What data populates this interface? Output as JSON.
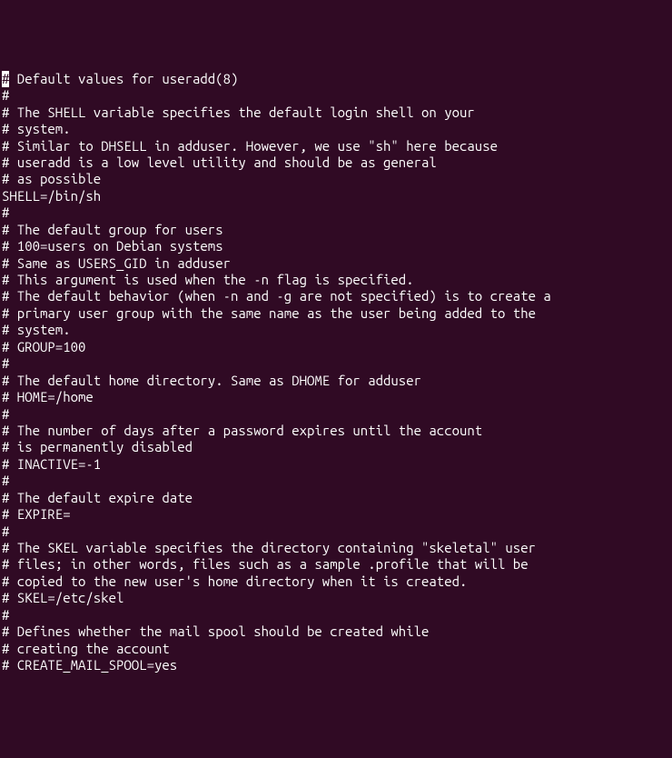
{
  "lines": [
    {
      "cursor": true,
      "cursorChar": "#",
      "rest": " Default values for useradd(8)"
    },
    {
      "text": "#"
    },
    {
      "text": "# The SHELL variable specifies the default login shell on your"
    },
    {
      "text": "# system."
    },
    {
      "text": "# Similar to DHSELL in adduser. However, we use \"sh\" here because"
    },
    {
      "text": "# useradd is a low level utility and should be as general"
    },
    {
      "text": "# as possible"
    },
    {
      "text": "SHELL=/bin/sh"
    },
    {
      "text": "#"
    },
    {
      "text": "# The default group for users"
    },
    {
      "text": "# 100=users on Debian systems"
    },
    {
      "text": "# Same as USERS_GID in adduser"
    },
    {
      "text": "# This argument is used when the -n flag is specified."
    },
    {
      "text": "# The default behavior (when -n and -g are not specified) is to create a"
    },
    {
      "text": "# primary user group with the same name as the user being added to the"
    },
    {
      "text": "# system."
    },
    {
      "text": "# GROUP=100"
    },
    {
      "text": "#"
    },
    {
      "text": "# The default home directory. Same as DHOME for adduser"
    },
    {
      "text": "# HOME=/home"
    },
    {
      "text": "#"
    },
    {
      "text": "# The number of days after a password expires until the account"
    },
    {
      "text": "# is permanently disabled"
    },
    {
      "text": "# INACTIVE=-1"
    },
    {
      "text": "#"
    },
    {
      "text": "# The default expire date"
    },
    {
      "text": "# EXPIRE="
    },
    {
      "text": "#"
    },
    {
      "text": "# The SKEL variable specifies the directory containing \"skeletal\" user"
    },
    {
      "text": "# files; in other words, files such as a sample .profile that will be"
    },
    {
      "text": "# copied to the new user's home directory when it is created."
    },
    {
      "text": "# SKEL=/etc/skel"
    },
    {
      "text": "#"
    },
    {
      "text": "# Defines whether the mail spool should be created while"
    },
    {
      "text": "# creating the account"
    },
    {
      "text": "# CREATE_MAIL_SPOOL=yes"
    }
  ]
}
